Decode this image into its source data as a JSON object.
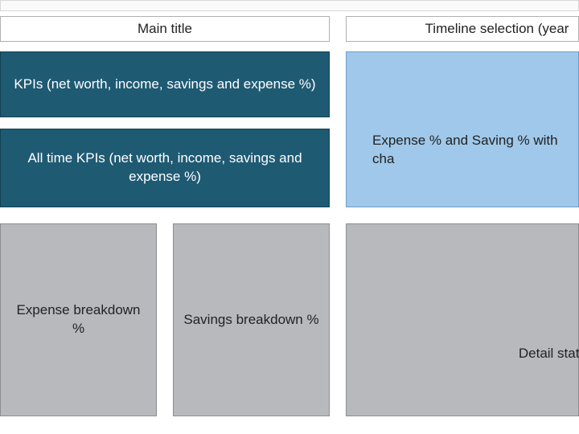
{
  "header": {
    "main_title": "Main title",
    "timeline_label": "Timeline selection (year"
  },
  "left": {
    "kpis_label": "KPIs (net worth, income, savings and expense %)",
    "alltime_kpis_label": "All time KPIs (net worth, income, savings and expense %)",
    "expense_breakdown_label": "Expense breakdown %",
    "savings_breakdown_label": "Savings breakdown %"
  },
  "right": {
    "expense_saving_chart_label": "Expense % and Saving % with cha",
    "detail_statement_label": "Detail statemen"
  },
  "colors": {
    "teal": "#1f5a73",
    "light_blue": "#a0c8ea",
    "gray": "#b7b9bd"
  }
}
